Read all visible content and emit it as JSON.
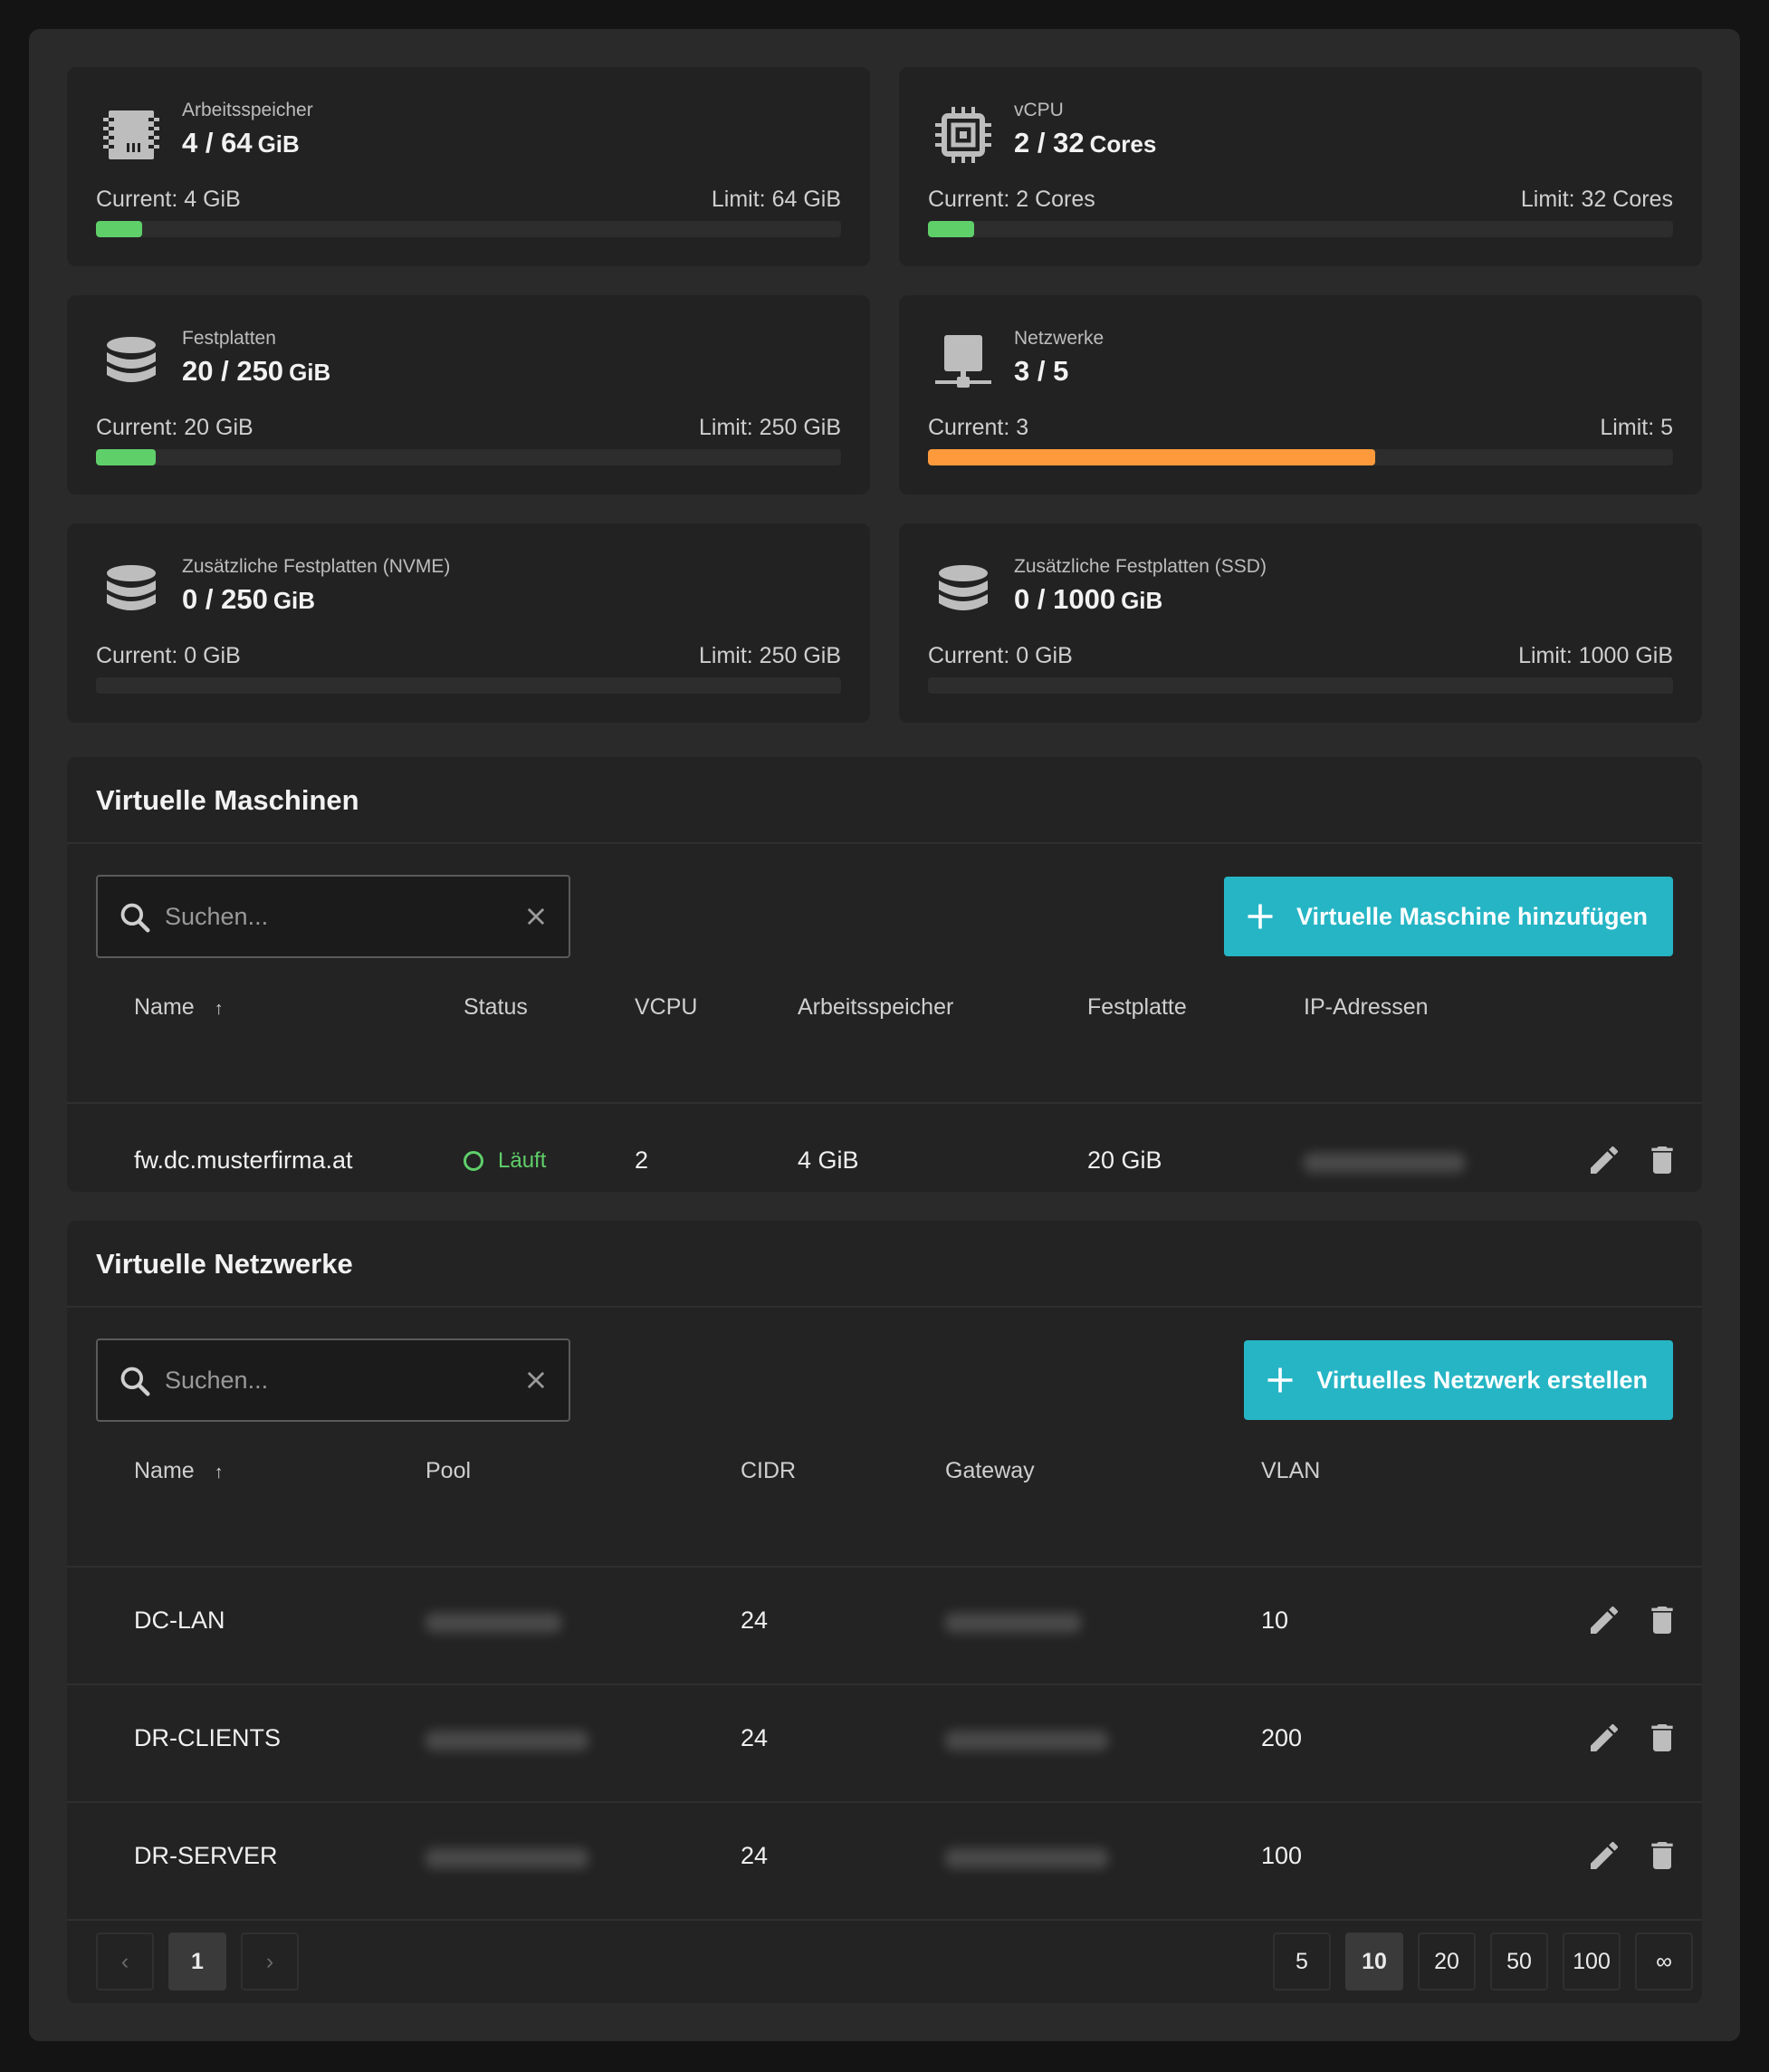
{
  "quotas": [
    {
      "label": "Arbeitsspeicher",
      "used": "4",
      "limit": "64",
      "unit": "GiB",
      "current_text": "Current: 4 GiB",
      "limit_text": "Limit: 64 GiB",
      "fill_fraction": 0.0625,
      "color": "#5fcf6a",
      "icon": "memory-icon"
    },
    {
      "label": "vCPU",
      "used": "2",
      "limit": "32",
      "unit": "Cores",
      "current_text": "Current: 2 Cores",
      "limit_text": "Limit: 32 Cores",
      "fill_fraction": 0.0625,
      "color": "#5fcf6a",
      "icon": "cpu-icon"
    },
    {
      "label": "Festplatten",
      "used": "20",
      "limit": "250",
      "unit": "GiB",
      "current_text": "Current: 20 GiB",
      "limit_text": "Limit: 250 GiB",
      "fill_fraction": 0.08,
      "color": "#5fcf6a",
      "icon": "database-icon"
    },
    {
      "label": "Netzwerke",
      "used": "3",
      "limit": "5",
      "unit": "",
      "current_text": "Current: 3",
      "limit_text": "Limit: 5",
      "fill_fraction": 0.6,
      "color": "#ff9a3c",
      "icon": "network-icon"
    },
    {
      "label": "Zusätzliche Festplatten (NVME)",
      "used": "0",
      "limit": "250",
      "unit": "GiB",
      "current_text": "Current: 0 GiB",
      "limit_text": "Limit: 250 GiB",
      "fill_fraction": 0,
      "color": "#5fcf6a",
      "icon": "database-icon"
    },
    {
      "label": "Zusätzliche Festplatten (SSD)",
      "used": "0",
      "limit": "1000",
      "unit": "GiB",
      "current_text": "Current: 0 GiB",
      "limit_text": "Limit: 1000 GiB",
      "fill_fraction": 0,
      "color": "#5fcf6a",
      "icon": "database-icon"
    }
  ],
  "vms": {
    "title": "Virtuelle Maschinen",
    "search_placeholder": "Suchen...",
    "add_label": "Virtuelle Maschine hinzufügen",
    "columns": [
      "Name",
      "Status",
      "VCPU",
      "Arbeitsspeicher",
      "Festplatte",
      "IP-Adressen"
    ],
    "sort_indicator": "↑",
    "rows": [
      {
        "name": "fw.dc.musterfirma.at",
        "status": "Läuft",
        "vcpu": "2",
        "memory": "4 GiB",
        "disk": "20 GiB"
      }
    ]
  },
  "networks": {
    "title": "Virtuelle Netzwerke",
    "search_placeholder": "Suchen...",
    "add_label": "Virtuelles Netzwerk erstellen",
    "columns": [
      "Name",
      "Pool",
      "CIDR",
      "Gateway",
      "VLAN"
    ],
    "sort_indicator": "↑",
    "rows": [
      {
        "name": "DC-LAN",
        "cidr": "24",
        "vlan": "10"
      },
      {
        "name": "DR-CLIENTS",
        "cidr": "24",
        "vlan": "200"
      },
      {
        "name": "DR-SERVER",
        "cidr": "24",
        "vlan": "100"
      }
    ]
  },
  "pagination": {
    "prev": "‹",
    "next": "›",
    "current_page": "1",
    "page_sizes": [
      "5",
      "10",
      "20",
      "50",
      "100",
      "∞"
    ],
    "active_size": "10"
  }
}
